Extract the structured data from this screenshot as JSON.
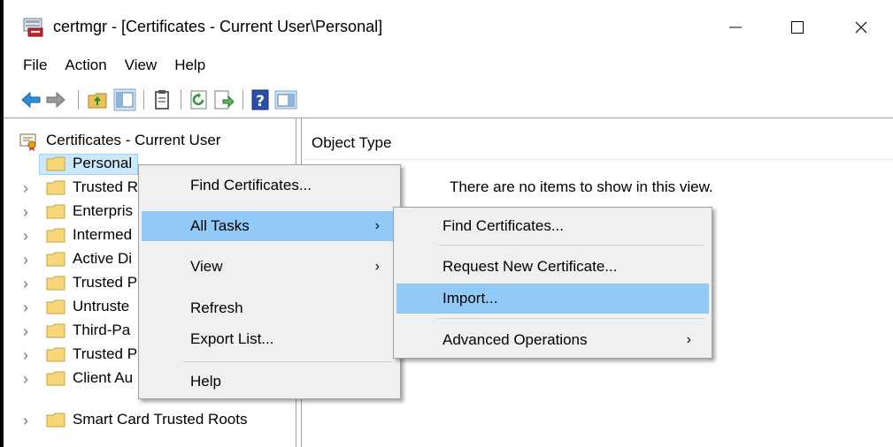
{
  "window": {
    "title": "certmgr - [Certificates - Current User\\Personal]",
    "controls": {
      "minimize": "—",
      "maximize": "☐",
      "close": "✕"
    }
  },
  "menubar": [
    "File",
    "Action",
    "View",
    "Help"
  ],
  "toolbar": {
    "buttons": [
      "back-icon",
      "forward-icon",
      "up-folder-icon",
      "show-hide-console-tree-icon",
      "properties-icon",
      "refresh-icon",
      "export-list-icon",
      "help-icon",
      "show-hide-action-pane-icon"
    ]
  },
  "tree": {
    "root": "Certificates - Current User",
    "items": [
      {
        "label": "Personal",
        "selected": true,
        "expandable": false
      },
      {
        "label": "Trusted R",
        "expandable": true
      },
      {
        "label": "Enterpris",
        "expandable": true
      },
      {
        "label": "Intermed",
        "expandable": true
      },
      {
        "label": "Active Di",
        "expandable": true
      },
      {
        "label": "Trusted P",
        "expandable": true
      },
      {
        "label": "Untruste",
        "expandable": true
      },
      {
        "label": "Third-Pa",
        "expandable": true
      },
      {
        "label": "Trusted P",
        "expandable": true
      },
      {
        "label": "Client Au",
        "expandable": true
      },
      {
        "label": "Smart Card Trusted Roots",
        "expandable": true
      }
    ]
  },
  "list": {
    "column_header": "Object Type",
    "empty_message": "There are no items to show in this view."
  },
  "context_menu": {
    "items": [
      "Find Certificates...",
      "All Tasks",
      "View",
      "Refresh",
      "Export List...",
      "Help"
    ],
    "highlighted": "All Tasks"
  },
  "submenu": {
    "items": [
      "Find Certificates...",
      "Request New Certificate...",
      "Import...",
      "Advanced Operations"
    ],
    "highlighted": "Import..."
  },
  "colors": {
    "menu_bg": "#f0f0f0",
    "highlight": "#91c9f7",
    "tree_selection": "#cce8ff",
    "folder_yellow": "#f6d77b"
  }
}
